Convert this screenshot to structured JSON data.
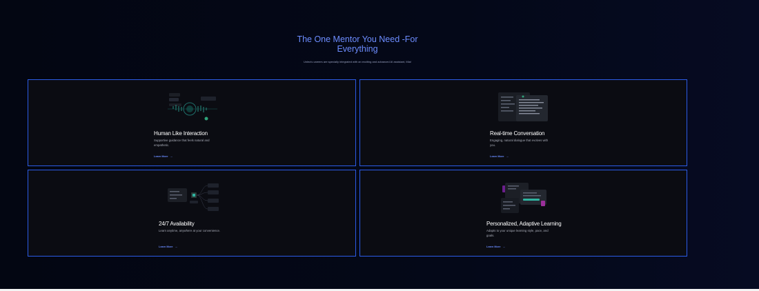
{
  "header": {
    "title": "The One Mentor You Need -For Everything",
    "subtitle": "Unlea's careers are specially integrated with an exciting and advanced AI assistant, Mia!"
  },
  "cards": [
    {
      "title": "Human Like Interaction",
      "description": "Supportive guidance that feels natural and empathetic.",
      "link": "Learn More",
      "arrow": "→"
    },
    {
      "title": "Real-time Conversation",
      "description": "Engaging, natural dialogue that evolves with you.",
      "link": "Learn More",
      "arrow": "→"
    },
    {
      "title": "24/7 Availability",
      "description": "Learn anytime, anywhere at your convenience.",
      "link": "Learn More",
      "arrow": "→"
    },
    {
      "title": "Personalized, Adaptive Learning",
      "description": "Adapts to your unique learning style, pace, and goals.",
      "link": "Learn More",
      "arrow": "→"
    }
  ],
  "colors": {
    "accent": "#6d8dff",
    "card_border": "#2c5ce8",
    "card_bg": "#0b0c12"
  }
}
